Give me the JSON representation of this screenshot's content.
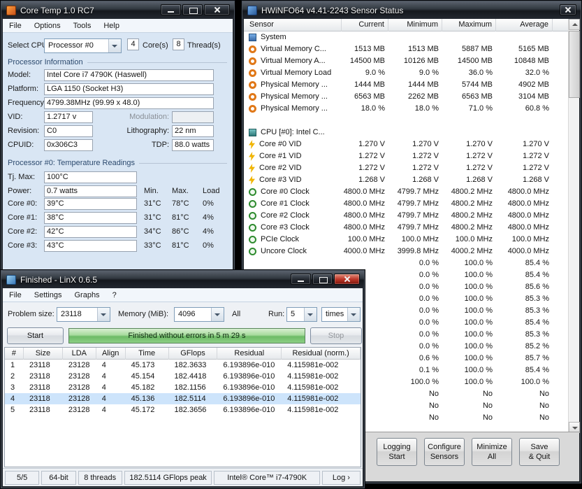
{
  "colors": {
    "selection_blue": "#cde4fb",
    "progress_green": "#6dbb66",
    "close_button_red": "#c0392b",
    "memory_icon_orange": "#e07818",
    "vid_icon_yellow": "#f0b400"
  },
  "coretemp": {
    "title": "Core Temp 1.0 RC7",
    "menu": [
      "File",
      "Options",
      "Tools",
      "Help"
    ],
    "select_cpu_label": "Select CPU:",
    "cpu_select": "Processor #0",
    "cores": "4",
    "cores_label": "Core(s)",
    "threads": "8",
    "threads_label": "Thread(s)",
    "info_header": "Processor Information",
    "model_label": "Model:",
    "model": "Intel Core i7 4790K (Haswell)",
    "platform_label": "Platform:",
    "platform": "LGA 1150 (Socket H3)",
    "frequency_label": "Frequency:",
    "frequency": "4799.38MHz (99.99 x 48.0)",
    "vid_label": "VID:",
    "vid": "1.2717 v",
    "modulation_label": "Modulation:",
    "modulation": "",
    "revision_label": "Revision:",
    "revision": "C0",
    "lithography_label": "Lithography:",
    "lithography": "22 nm",
    "cpuid_label": "CPUID:",
    "cpuid": "0x306C3",
    "tdp_label": "TDP:",
    "tdp": "88.0 watts",
    "temp_header": "Processor #0: Temperature Readings",
    "tjmax_label": "Tj. Max:",
    "tjmax": "100°C",
    "power_label": "Power:",
    "power": "0.7 watts",
    "col_min": "Min.",
    "col_max": "Max.",
    "col_load": "Load",
    "core_rows": [
      {
        "label": "Core #0:",
        "temp": "39°C",
        "min": "31°C",
        "max": "78°C",
        "load": "0%"
      },
      {
        "label": "Core #1:",
        "temp": "38°C",
        "min": "31°C",
        "max": "81°C",
        "load": "4%"
      },
      {
        "label": "Core #2:",
        "temp": "42°C",
        "min": "34°C",
        "max": "86°C",
        "load": "4%"
      },
      {
        "label": "Core #3:",
        "temp": "43°C",
        "min": "33°C",
        "max": "81°C",
        "load": "0%"
      }
    ]
  },
  "hwinfo": {
    "title": "HWiNFO64 v4.41-2243 Sensor Status",
    "columns": [
      "Sensor",
      "Current",
      "Minimum",
      "Maximum",
      "Average"
    ],
    "rows": [
      {
        "label": "System",
        "icon": "icon-system",
        "current": "",
        "min": "",
        "max": "",
        "avg": ""
      },
      {
        "label": "Virtual Memory C...",
        "icon": "icon-memory",
        "current": "1513 MB",
        "min": "1513 MB",
        "max": "5887 MB",
        "avg": "5165 MB"
      },
      {
        "label": "Virtual Memory A...",
        "icon": "icon-memory",
        "current": "14500 MB",
        "min": "10126 MB",
        "max": "14500 MB",
        "avg": "10848 MB"
      },
      {
        "label": "Virtual Memory Load",
        "icon": "icon-memory",
        "current": "9.0 %",
        "min": "9.0 %",
        "max": "36.0 %",
        "avg": "32.0 %"
      },
      {
        "label": "Physical Memory ...",
        "icon": "icon-memory",
        "current": "1444 MB",
        "min": "1444 MB",
        "max": "5744 MB",
        "avg": "4902 MB"
      },
      {
        "label": "Physical Memory ...",
        "icon": "icon-memory",
        "current": "6563 MB",
        "min": "2262 MB",
        "max": "6563 MB",
        "avg": "3104 MB"
      },
      {
        "label": "Physical Memory ...",
        "icon": "icon-memory",
        "current": "18.0 %",
        "min": "18.0 %",
        "max": "71.0 %",
        "avg": "60.8 %"
      },
      {
        "label": "",
        "icon": "",
        "current": "",
        "min": "",
        "max": "",
        "avg": ""
      },
      {
        "label": "CPU [#0]: Intel C...",
        "icon": "icon-cpu",
        "current": "",
        "min": "",
        "max": "",
        "avg": ""
      },
      {
        "label": "Core #0 VID",
        "icon": "icon-bolt",
        "current": "1.270 V",
        "min": "1.270 V",
        "max": "1.270 V",
        "avg": "1.270 V"
      },
      {
        "label": "Core #1 VID",
        "icon": "icon-bolt",
        "current": "1.272 V",
        "min": "1.272 V",
        "max": "1.272 V",
        "avg": "1.272 V"
      },
      {
        "label": "Core #2 VID",
        "icon": "icon-bolt",
        "current": "1.272 V",
        "min": "1.272 V",
        "max": "1.272 V",
        "avg": "1.272 V"
      },
      {
        "label": "Core #3 VID",
        "icon": "icon-bolt",
        "current": "1.268 V",
        "min": "1.268 V",
        "max": "1.268 V",
        "avg": "1.268 V"
      },
      {
        "label": "Core #0 Clock",
        "icon": "icon-clock",
        "current": "4800.0 MHz",
        "min": "4799.7 MHz",
        "max": "4800.2 MHz",
        "avg": "4800.0 MHz"
      },
      {
        "label": "Core #1 Clock",
        "icon": "icon-clock",
        "current": "4800.0 MHz",
        "min": "4799.7 MHz",
        "max": "4800.2 MHz",
        "avg": "4800.0 MHz"
      },
      {
        "label": "Core #2 Clock",
        "icon": "icon-clock",
        "current": "4800.0 MHz",
        "min": "4799.7 MHz",
        "max": "4800.2 MHz",
        "avg": "4800.0 MHz"
      },
      {
        "label": "Core #3 Clock",
        "icon": "icon-clock",
        "current": "4800.0 MHz",
        "min": "4799.7 MHz",
        "max": "4800.2 MHz",
        "avg": "4800.0 MHz"
      },
      {
        "label": "PCIe Clock",
        "icon": "icon-clock",
        "current": "100.0 MHz",
        "min": "100.0 MHz",
        "max": "100.0 MHz",
        "avg": "100.0 MHz"
      },
      {
        "label": "Uncore Clock",
        "icon": "icon-clock",
        "current": "4000.0 MHz",
        "min": "3999.8 MHz",
        "max": "4000.2 MHz",
        "avg": "4000.0 MHz"
      },
      {
        "label": "",
        "icon": "",
        "current": "",
        "min": "0.0 %",
        "max": "100.0 %",
        "avg": "85.4 %"
      },
      {
        "label": "",
        "icon": "",
        "current": "",
        "min": "0.0 %",
        "max": "100.0 %",
        "avg": "85.4 %"
      },
      {
        "label": "",
        "icon": "",
        "current": "",
        "min": "0.0 %",
        "max": "100.0 %",
        "avg": "85.6 %"
      },
      {
        "label": "",
        "icon": "",
        "current": "",
        "min": "0.0 %",
        "max": "100.0 %",
        "avg": "85.3 %"
      },
      {
        "label": "",
        "icon": "",
        "current": "",
        "min": "0.0 %",
        "max": "100.0 %",
        "avg": "85.3 %"
      },
      {
        "label": "",
        "icon": "",
        "current": "",
        "min": "0.0 %",
        "max": "100.0 %",
        "avg": "85.4 %"
      },
      {
        "label": "",
        "icon": "",
        "current": "",
        "min": "0.0 %",
        "max": "100.0 %",
        "avg": "85.3 %"
      },
      {
        "label": "",
        "icon": "",
        "current": "",
        "min": "0.0 %",
        "max": "100.0 %",
        "avg": "85.2 %"
      },
      {
        "label": "",
        "icon": "",
        "current": "",
        "min": "0.6 %",
        "max": "100.0 %",
        "avg": "85.7 %"
      },
      {
        "label": "",
        "icon": "",
        "current": "",
        "min": "0.1 %",
        "max": "100.0 %",
        "avg": "85.4 %"
      },
      {
        "label": "",
        "icon": "",
        "current": "",
        "min": "100.0 %",
        "max": "100.0 %",
        "avg": "100.0 %"
      },
      {
        "label": "",
        "icon": "",
        "current": "",
        "min": "No",
        "max": "No",
        "avg": "No"
      },
      {
        "label": "",
        "icon": "",
        "current": "",
        "min": "No",
        "max": "No",
        "avg": "No"
      },
      {
        "label": "",
        "icon": "",
        "current": "",
        "min": "No",
        "max": "No",
        "avg": "No"
      }
    ],
    "buttons": [
      {
        "label": "Logging\nStart"
      },
      {
        "label": "Configure\nSensors"
      },
      {
        "label": "Minimize\nAll"
      },
      {
        "label": "Save\n& Quit"
      }
    ]
  },
  "linx": {
    "title": "Finished - LinX 0.6.5",
    "menu": [
      "File",
      "Settings",
      "Graphs",
      "?"
    ],
    "problem_size_label": "Problem size:",
    "problem_size_value": "23118",
    "memory_label": "Memory (MiB):",
    "memory_value": "4096",
    "all_label": "All",
    "run_label": "Run:",
    "run_value": "5",
    "times_value": "times",
    "start_button": "Start",
    "progress_text": "Finished without errors in 5 m 29 s",
    "stop_button": "Stop",
    "columns": [
      "#",
      "Size",
      "LDA",
      "Align",
      "Time",
      "GFlops",
      "Residual",
      "Residual (norm.)"
    ],
    "rows": [
      {
        "n": "1",
        "size": "23118",
        "lda": "23128",
        "align": "4",
        "time": "45.173",
        "gflops": "182.3633",
        "residual": "6.193896e-010",
        "residual_norm": "4.115981e-002"
      },
      {
        "n": "2",
        "size": "23118",
        "lda": "23128",
        "align": "4",
        "time": "45.154",
        "gflops": "182.4418",
        "residual": "6.193896e-010",
        "residual_norm": "4.115981e-002"
      },
      {
        "n": "3",
        "size": "23118",
        "lda": "23128",
        "align": "4",
        "time": "45.182",
        "gflops": "182.1156",
        "residual": "6.193896e-010",
        "residual_norm": "4.115981e-002"
      },
      {
        "n": "4",
        "size": "23118",
        "lda": "23128",
        "align": "4",
        "time": "45.136",
        "gflops": "182.5114",
        "residual": "6.193896e-010",
        "residual_norm": "4.115981e-002",
        "row_class": "selected"
      },
      {
        "n": "5",
        "size": "23118",
        "lda": "23128",
        "align": "4",
        "time": "45.172",
        "gflops": "182.3656",
        "residual": "6.193896e-010",
        "residual_norm": "4.115981e-002"
      }
    ],
    "status": {
      "progress": "5/5",
      "arch": "64-bit",
      "threads": "8 threads",
      "peak": "182.5114 GFlops peak",
      "cpu": "Intel® Core™ i7-4790K",
      "log_label": "Log",
      "log_chevron": "›"
    }
  }
}
